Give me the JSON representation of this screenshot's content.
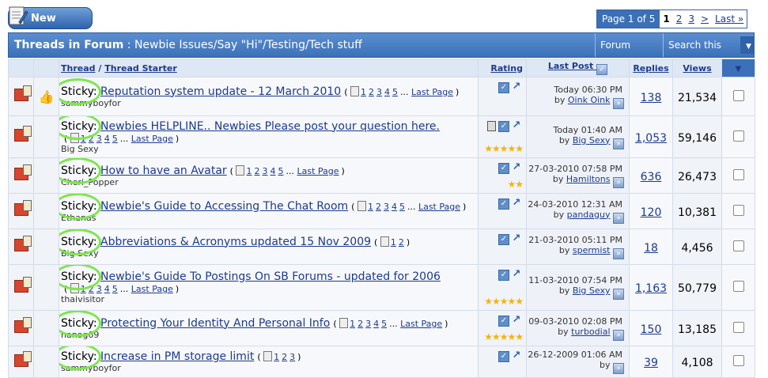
{
  "new_thread_label": "New Thread",
  "pager": {
    "label": "Page 1 of 5",
    "pages": [
      "1",
      "2",
      "3"
    ],
    "next": ">",
    "last": "Last »"
  },
  "forum": {
    "heading": "Threads in Forum",
    "name": "Newbie Issues/Say \"Hi\"/Testing/Tech stuff"
  },
  "tools": {
    "forum_tools": "Forum Tools",
    "search": "Search this Forum"
  },
  "columns": {
    "thread": "Thread",
    "separator": "/",
    "starter": "Thread Starter",
    "rating": "Rating",
    "last_post": "Last Post",
    "replies": "Replies",
    "views": "Views"
  },
  "sticky_label": "Sticky:",
  "last_page_label": "Last Page",
  "ellipsis": "...",
  "by_label": "by",
  "threads": [
    {
      "title": "Reputation system update - 12 March 2010",
      "starter": "sammyboyfor",
      "pages": [
        "1",
        "2",
        "3",
        "4",
        "5"
      ],
      "pages_inline": true,
      "has_last": true,
      "date": "Today 06:30 PM",
      "last_user": "Oink Oink",
      "replies": "138",
      "views": "21,534",
      "stars": "",
      "thumb": true,
      "trash": false
    },
    {
      "title": "Newbies HELPLINE.. Newbies Please post your question here.",
      "starter": "Big Sexy",
      "pages": [
        "1",
        "2",
        "3",
        "4",
        "5"
      ],
      "pages_inline": false,
      "has_last": true,
      "date": "Today 01:40 AM",
      "last_user": "Big Sexy",
      "replies": "1,053",
      "views": "59,146",
      "stars": "★★★★★",
      "thumb": false,
      "trash": true
    },
    {
      "title": "How to have an Avatar",
      "starter": "Cheri_Popper",
      "pages": [
        "1",
        "2",
        "3",
        "4",
        "5"
      ],
      "pages_inline": true,
      "has_last": true,
      "date": "27-03-2010 07:58 PM",
      "last_user": "Hamiltons",
      "replies": "636",
      "views": "26,473",
      "stars": "★★",
      "thumb": false,
      "trash": false
    },
    {
      "title": "Newbie's Guide to Accessing The Chat Room",
      "starter": "Ethanas",
      "pages": [
        "1",
        "2",
        "3",
        "4",
        "5"
      ],
      "pages_inline": true,
      "has_last": true,
      "date": "24-03-2010 12:31 AM",
      "last_user": "pandaguy",
      "replies": "120",
      "views": "10,381",
      "stars": "",
      "thumb": false,
      "trash": false
    },
    {
      "title": "Abbreviations & Acronyms updated 15 Nov 2009",
      "starter": "Big Sexy",
      "pages": [
        "1",
        "2"
      ],
      "pages_inline": true,
      "has_last": false,
      "date": "21-03-2010 05:11 PM",
      "last_user": "spermist",
      "replies": "18",
      "views": "4,456",
      "stars": "",
      "thumb": false,
      "trash": false
    },
    {
      "title": "Newbie's Guide To Postings On SB Forums - updated for 2006",
      "starter": "thaivisitor",
      "pages": [
        "1",
        "2",
        "3",
        "4",
        "5"
      ],
      "pages_inline": false,
      "has_last": true,
      "date": "11-03-2010 07:54 PM",
      "last_user": "Big Sexy",
      "replies": "1,163",
      "views": "50,779",
      "stars": "★★★★★",
      "thumb": false,
      "trash": false
    },
    {
      "title": "Protecting Your Identity And Personal Info",
      "starter": "nanog69",
      "pages": [
        "1",
        "2",
        "3",
        "4",
        "5"
      ],
      "pages_inline": true,
      "has_last": true,
      "date": "09-03-2010 02:08 PM",
      "last_user": "turbodial",
      "replies": "150",
      "views": "13,185",
      "stars": "★★★★★",
      "thumb": false,
      "trash": false
    },
    {
      "title": "Increase in PM storage limit",
      "starter": "sammyboyfor",
      "pages": [
        "1",
        "2",
        "3"
      ],
      "pages_inline": true,
      "has_last": false,
      "date": "26-12-2009 01:06 AM",
      "last_user": "",
      "replies": "39",
      "views": "4,108",
      "stars": "",
      "thumb": false,
      "trash": false
    }
  ]
}
